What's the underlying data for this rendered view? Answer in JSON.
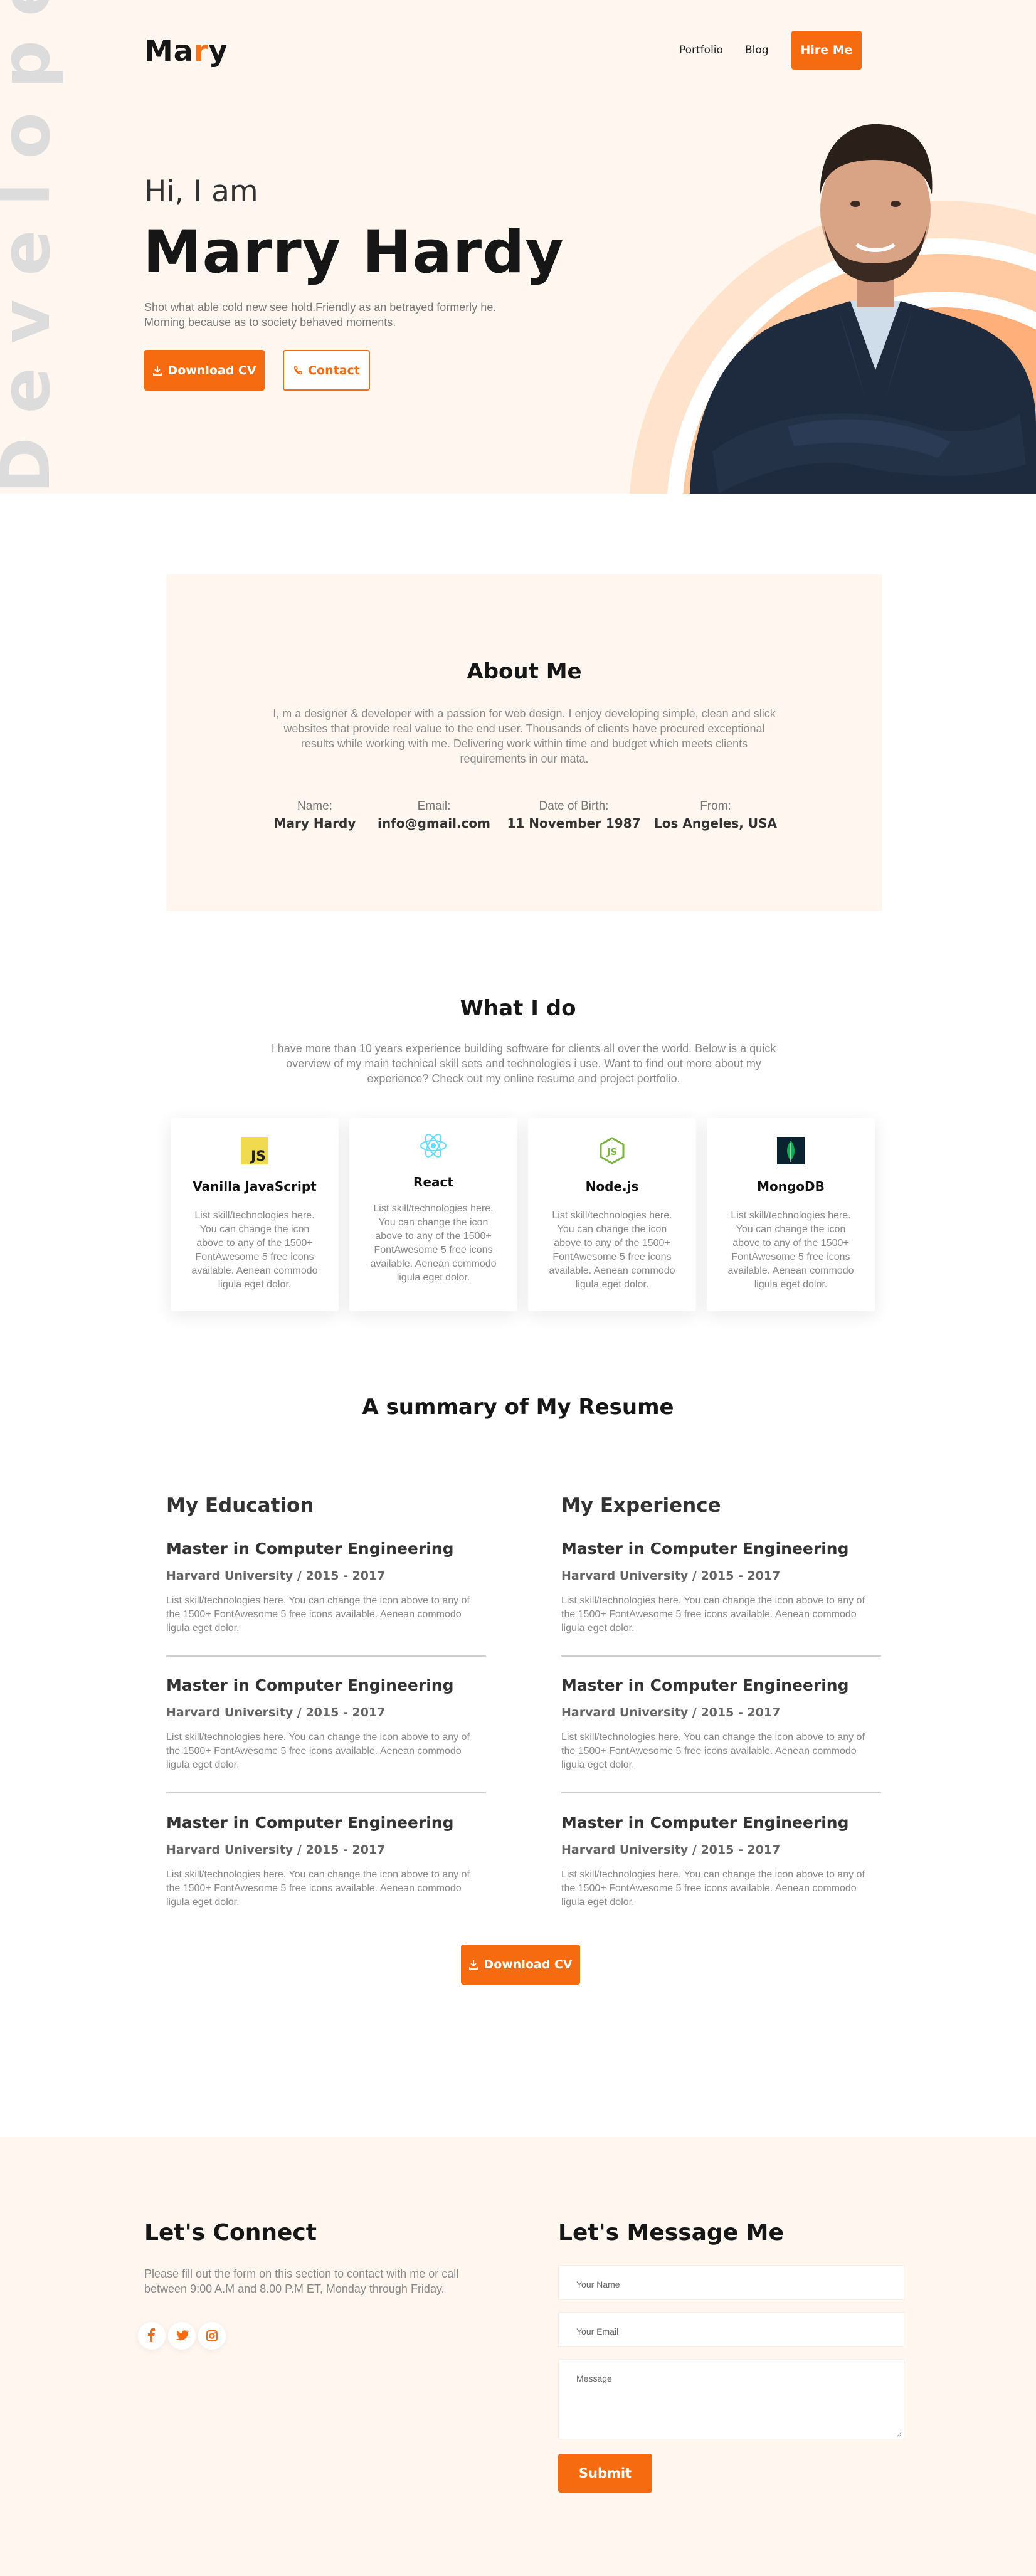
{
  "header": {
    "logo_prefix": "Ma",
    "logo_accent": "r",
    "logo_suffix": "y",
    "nav": [
      "Portfolio",
      "Blog"
    ],
    "hire_label": "Hire Me"
  },
  "hero": {
    "vertical_text": "Developer",
    "greeting": "Hi, I am",
    "name": "Marry Hardy",
    "description": "Shot what able cold new see hold.Friendly as an betrayed formerly he. Morning because as to society behaved moments.",
    "download_label": "Download CV",
    "contact_label": "Contact"
  },
  "about": {
    "title": "About Me",
    "text": "I, m a designer & developer with a passion for web design. I enjoy developing simple, clean and slick websites that provide real value to the end user. Thousands of clients have procured exceptional results while working with me. Delivering work within time and budget which meets clients requirements in our mata.",
    "info": [
      {
        "label": "Name:",
        "value": "Mary Hardy"
      },
      {
        "label": "Email:",
        "value": "info@gmail.com"
      },
      {
        "label": "Date of Birth:",
        "value": "11 November 1987"
      },
      {
        "label": "From:",
        "value": "Los Angeles, USA"
      }
    ]
  },
  "skills": {
    "title": "What I do",
    "text": "I have more than 10 years experience building software for clients all over the world. Below is a quick overview of my main technical skill sets and technologies i use. Want to find out more about my experience? Check out my online resume and project portfolio.",
    "cards": [
      {
        "icon": "javascript-icon",
        "title": "Vanilla JavaScript",
        "text": "List skill/technologies here. You can change the icon above to any of the 1500+ FontAwesome 5 free icons available. Aenean commodo ligula eget dolor."
      },
      {
        "icon": "react-icon",
        "title": "React",
        "text": "List skill/technologies here. You can change the icon above to any of the 1500+ FontAwesome 5 free icons available. Aenean commodo ligula eget dolor."
      },
      {
        "icon": "nodejs-icon",
        "title": "Node.js",
        "text": "List skill/technologies here. You can change the icon above to any of the 1500+ FontAwesome 5 free icons available. Aenean commodo ligula eget dolor."
      },
      {
        "icon": "mongodb-icon",
        "title": "MongoDB",
        "text": "List skill/technologies here. You can change the icon above to any of the 1500+ FontAwesome 5 free icons available. Aenean commodo ligula eget dolor."
      }
    ]
  },
  "resume": {
    "title": "A summary of My Resume",
    "education_title": "My Education",
    "experience_title": "My Experience",
    "education": [
      {
        "title": "Master in Computer Engineering",
        "subtitle": "Harvard University / 2015 - 2017",
        "text": "List skill/technologies here. You can change the icon above to any of the 1500+ FontAwesome 5 free icons available. Aenean commodo ligula eget dolor."
      },
      {
        "title": "Master in Computer Engineering",
        "subtitle": "Harvard University / 2015 - 2017",
        "text": "List skill/technologies here. You can change the icon above to any of the 1500+ FontAwesome 5 free icons available. Aenean commodo ligula eget dolor."
      },
      {
        "title": "Master in Computer Engineering",
        "subtitle": "Harvard University / 2015 - 2017",
        "text": "List skill/technologies here. You can change the icon above to any of the 1500+ FontAwesome 5 free icons available. Aenean commodo ligula eget dolor."
      }
    ],
    "experience": [
      {
        "title": "Master in Computer Engineering",
        "subtitle": "Harvard University / 2015 - 2017",
        "text": "List skill/technologies here. You can change the icon above to any of the 1500+ FontAwesome 5 free icons available. Aenean commodo ligula eget dolor."
      },
      {
        "title": "Master in Computer Engineering",
        "subtitle": "Harvard University / 2015 - 2017",
        "text": "List skill/technologies here. You can change the icon above to any of the 1500+ FontAwesome 5 free icons available. Aenean commodo ligula eget dolor."
      },
      {
        "title": "Master in Computer Engineering",
        "subtitle": "Harvard University / 2015 - 2017",
        "text": "List skill/technologies here. You can change the icon above to any of the 1500+ FontAwesome 5 free icons available. Aenean commodo ligula eget dolor."
      }
    ],
    "download_label": "Download CV"
  },
  "connect": {
    "title": "Let's Connect",
    "text": "Please fill out the form on this section to contact with me or call between 9:00 A.M and 8.00 P.M ET, Monday through Friday.",
    "socials": [
      "facebook-icon",
      "twitter-icon",
      "instagram-icon"
    ]
  },
  "message": {
    "title": "Let's Message Me",
    "name_placeholder": "Your Name",
    "email_placeholder": "Your Email",
    "message_placeholder": "Message",
    "submit_label": "Submit"
  },
  "colors": {
    "accent": "#f76b10",
    "hero_bg": "#fff6ef",
    "circle_outer": "#ffe3cc",
    "circle_mid": "#ffcaa1",
    "circle_inner": "#ffb07a"
  }
}
